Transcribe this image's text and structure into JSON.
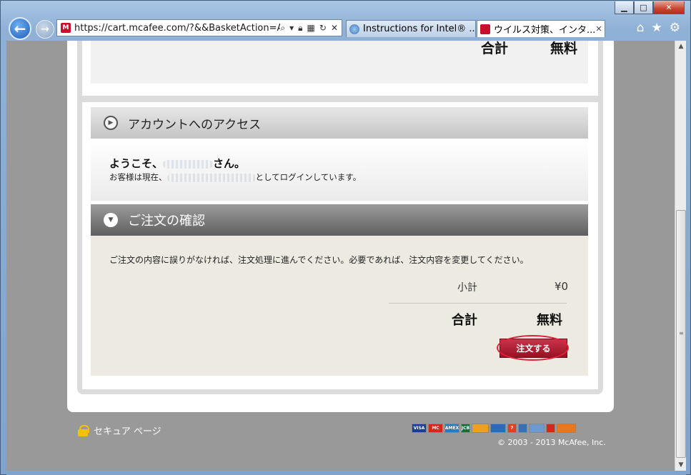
{
  "browser": {
    "url": "https://cart.mcafee.com/?&&BasketAction=AD",
    "tabs": [
      {
        "label": "Instructions for Intel® ..."
      },
      {
        "label": "ウイルス対策、インタ..."
      }
    ],
    "window_controls": {
      "minimize": "▁",
      "maximize": "□",
      "close": "✕"
    }
  },
  "summary_top": {
    "total_label": "合計",
    "total_value": "無料"
  },
  "account_section": {
    "title": "アカウントへのアクセス",
    "welcome_prefix": "ようこそ、",
    "welcome_suffix": "さん。",
    "login_prefix": "お客様は現在、",
    "login_suffix": "としてログインしています。"
  },
  "confirm_section": {
    "title": "ご注文の確認",
    "message": "ご注文の内容に誤りがなければ、注文処理に進んでください。必要であれば、注文内容を変更してください。",
    "subtotal_label": "小計",
    "subtotal_value": "¥0",
    "total_label": "合計",
    "total_value": "無料",
    "order_button": "注文する"
  },
  "footer": {
    "secure_label": "セキュア ページ",
    "copyright": "© 2003 - 2013 McAfee, Inc.",
    "payment_cards": [
      {
        "label": "VISA",
        "color": "#1a3f8f"
      },
      {
        "label": "MC",
        "color": "#d8261b"
      },
      {
        "label": "AMEX",
        "color": "#2a7ac0"
      },
      {
        "label": "JCB",
        "color": "#1c6c3a"
      },
      {
        "label": "",
        "color": "#f0a020"
      },
      {
        "label": "",
        "color": "#2a6cb8"
      },
      {
        "label": "7",
        "color": "#e0401a"
      },
      {
        "label": "",
        "color": "#3a6fb8"
      },
      {
        "label": "",
        "color": "#6a9ad0"
      },
      {
        "label": "",
        "color": "#d8261b"
      },
      {
        "label": "",
        "color": "#e87820"
      }
    ]
  }
}
